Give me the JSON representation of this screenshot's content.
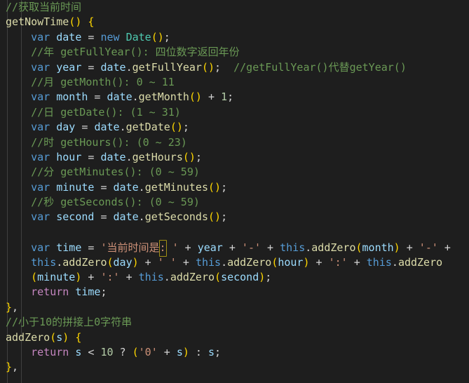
{
  "editor": {
    "theme_name": "dark-plus",
    "background_color": "#1e1e1e",
    "language": "javascript",
    "font_size_px": 15,
    "line_height_px": 21.4,
    "colors": {
      "comment": "#6a9955",
      "keyword": "#569cd6",
      "identifier": "#9cdcfe",
      "function": "#dcdcaa",
      "type": "#4ec9b0",
      "string": "#ce9178",
      "number": "#b5cea8",
      "control": "#c586c0",
      "punctuation": "#d4d4d4",
      "bracket_level_0": "#ffd700",
      "bracket_level_1": "#da70d6",
      "bracket_level_2": "#179fff",
      "indent_guide": "#404040",
      "match_highlight_border": "#a39014"
    },
    "indent_guides": [
      10,
      30
    ],
    "partial_top_line_text": "//"
  },
  "lines": [
    {
      "n": 1,
      "tokens": [
        {
          "c": "t-com",
          "s": "//获取当前时间"
        }
      ]
    },
    {
      "n": 2,
      "tokens": [
        {
          "c": "t-fn",
          "s": "getNowTime"
        },
        {
          "c": "t-br0",
          "s": "()"
        },
        {
          "c": "t-pun",
          "s": " "
        },
        {
          "c": "t-br0",
          "s": "{"
        }
      ]
    },
    {
      "n": 3,
      "tokens": [
        {
          "c": "t-pun",
          "s": "    "
        },
        {
          "c": "t-kw",
          "s": "var"
        },
        {
          "c": "t-pun",
          "s": " "
        },
        {
          "c": "t-var",
          "s": "date"
        },
        {
          "c": "t-op",
          "s": " = "
        },
        {
          "c": "t-kw",
          "s": "new"
        },
        {
          "c": "t-pun",
          "s": " "
        },
        {
          "c": "t-type",
          "s": "Date"
        },
        {
          "c": "t-br0",
          "s": "()"
        },
        {
          "c": "t-pun",
          "s": ";"
        }
      ]
    },
    {
      "n": 4,
      "tokens": [
        {
          "c": "t-pun",
          "s": "    "
        },
        {
          "c": "t-com",
          "s": "//年 getFullYear(): 四位数字返回年份"
        }
      ]
    },
    {
      "n": 5,
      "tokens": [
        {
          "c": "t-pun",
          "s": "    "
        },
        {
          "c": "t-kw",
          "s": "var"
        },
        {
          "c": "t-pun",
          "s": " "
        },
        {
          "c": "t-var",
          "s": "year"
        },
        {
          "c": "t-op",
          "s": " = "
        },
        {
          "c": "t-var",
          "s": "date"
        },
        {
          "c": "t-pun",
          "s": "."
        },
        {
          "c": "t-fn",
          "s": "getFullYear"
        },
        {
          "c": "t-br0",
          "s": "()"
        },
        {
          "c": "t-pun",
          "s": ";  "
        },
        {
          "c": "t-com",
          "s": "//getFullYear()代替getYear()"
        }
      ]
    },
    {
      "n": 6,
      "tokens": [
        {
          "c": "t-pun",
          "s": "    "
        },
        {
          "c": "t-com",
          "s": "//月 getMonth(): 0 ~ 11"
        }
      ]
    },
    {
      "n": 7,
      "tokens": [
        {
          "c": "t-pun",
          "s": "    "
        },
        {
          "c": "t-kw",
          "s": "var"
        },
        {
          "c": "t-pun",
          "s": " "
        },
        {
          "c": "t-var",
          "s": "month"
        },
        {
          "c": "t-op",
          "s": " = "
        },
        {
          "c": "t-var",
          "s": "date"
        },
        {
          "c": "t-pun",
          "s": "."
        },
        {
          "c": "t-fn",
          "s": "getMonth"
        },
        {
          "c": "t-br0",
          "s": "()"
        },
        {
          "c": "t-op",
          "s": " + "
        },
        {
          "c": "t-num",
          "s": "1"
        },
        {
          "c": "t-pun",
          "s": ";"
        }
      ]
    },
    {
      "n": 8,
      "tokens": [
        {
          "c": "t-pun",
          "s": "    "
        },
        {
          "c": "t-com",
          "s": "//日 getDate(): (1 ~ 31)"
        }
      ]
    },
    {
      "n": 9,
      "tokens": [
        {
          "c": "t-pun",
          "s": "    "
        },
        {
          "c": "t-kw",
          "s": "var"
        },
        {
          "c": "t-pun",
          "s": " "
        },
        {
          "c": "t-var",
          "s": "day"
        },
        {
          "c": "t-op",
          "s": " = "
        },
        {
          "c": "t-var",
          "s": "date"
        },
        {
          "c": "t-pun",
          "s": "."
        },
        {
          "c": "t-fn",
          "s": "getDate"
        },
        {
          "c": "t-br0",
          "s": "()"
        },
        {
          "c": "t-pun",
          "s": ";"
        }
      ]
    },
    {
      "n": 10,
      "tokens": [
        {
          "c": "t-pun",
          "s": "    "
        },
        {
          "c": "t-com",
          "s": "//时 getHours(): (0 ~ 23)"
        }
      ]
    },
    {
      "n": 11,
      "tokens": [
        {
          "c": "t-pun",
          "s": "    "
        },
        {
          "c": "t-kw",
          "s": "var"
        },
        {
          "c": "t-pun",
          "s": " "
        },
        {
          "c": "t-var",
          "s": "hour"
        },
        {
          "c": "t-op",
          "s": " = "
        },
        {
          "c": "t-var",
          "s": "date"
        },
        {
          "c": "t-pun",
          "s": "."
        },
        {
          "c": "t-fn",
          "s": "getHours"
        },
        {
          "c": "t-br0",
          "s": "()"
        },
        {
          "c": "t-pun",
          "s": ";"
        }
      ]
    },
    {
      "n": 12,
      "tokens": [
        {
          "c": "t-pun",
          "s": "    "
        },
        {
          "c": "t-com",
          "s": "//分 getMinutes(): (0 ~ 59)"
        }
      ]
    },
    {
      "n": 13,
      "tokens": [
        {
          "c": "t-pun",
          "s": "    "
        },
        {
          "c": "t-kw",
          "s": "var"
        },
        {
          "c": "t-pun",
          "s": " "
        },
        {
          "c": "t-var",
          "s": "minute"
        },
        {
          "c": "t-op",
          "s": " = "
        },
        {
          "c": "t-var",
          "s": "date"
        },
        {
          "c": "t-pun",
          "s": "."
        },
        {
          "c": "t-fn",
          "s": "getMinutes"
        },
        {
          "c": "t-br0",
          "s": "()"
        },
        {
          "c": "t-pun",
          "s": ";"
        }
      ]
    },
    {
      "n": 14,
      "tokens": [
        {
          "c": "t-pun",
          "s": "    "
        },
        {
          "c": "t-com",
          "s": "//秒 getSeconds(): (0 ~ 59)"
        }
      ]
    },
    {
      "n": 15,
      "tokens": [
        {
          "c": "t-pun",
          "s": "    "
        },
        {
          "c": "t-kw",
          "s": "var"
        },
        {
          "c": "t-pun",
          "s": " "
        },
        {
          "c": "t-var",
          "s": "second"
        },
        {
          "c": "t-op",
          "s": " = "
        },
        {
          "c": "t-var",
          "s": "date"
        },
        {
          "c": "t-pun",
          "s": "."
        },
        {
          "c": "t-fn",
          "s": "getSeconds"
        },
        {
          "c": "t-br0",
          "s": "()"
        },
        {
          "c": "t-pun",
          "s": ";"
        }
      ]
    },
    {
      "n": 16,
      "tokens": []
    },
    {
      "n": 17,
      "tokens": [
        {
          "c": "t-pun",
          "s": "    "
        },
        {
          "c": "t-kw",
          "s": "var"
        },
        {
          "c": "t-pun",
          "s": " "
        },
        {
          "c": "t-var",
          "s": "time"
        },
        {
          "c": "t-op",
          "s": " = "
        },
        {
          "c": "t-str",
          "s": "'当前时间是"
        },
        {
          "c": "t-str",
          "s": ":",
          "match": true
        },
        {
          "c": "t-str",
          "s": " '"
        },
        {
          "c": "t-op",
          "s": " + "
        },
        {
          "c": "t-var",
          "s": "year"
        },
        {
          "c": "t-op",
          "s": " + "
        },
        {
          "c": "t-str",
          "s": "'-'"
        },
        {
          "c": "t-op",
          "s": " + "
        },
        {
          "c": "t-kw",
          "s": "this"
        },
        {
          "c": "t-pun",
          "s": "."
        },
        {
          "c": "t-fn",
          "s": "addZero"
        },
        {
          "c": "t-br0",
          "s": "("
        },
        {
          "c": "t-var",
          "s": "month"
        },
        {
          "c": "t-br0",
          "s": ")"
        },
        {
          "c": "t-op",
          "s": " + "
        },
        {
          "c": "t-str",
          "s": "'-'"
        },
        {
          "c": "t-op",
          "s": " +"
        }
      ]
    },
    {
      "n": 18,
      "tokens": [
        {
          "c": "t-pun",
          "s": "    "
        },
        {
          "c": "t-kw",
          "s": "this"
        },
        {
          "c": "t-pun",
          "s": "."
        },
        {
          "c": "t-fn",
          "s": "addZero"
        },
        {
          "c": "t-br0",
          "s": "("
        },
        {
          "c": "t-var",
          "s": "day"
        },
        {
          "c": "t-br0",
          "s": ")"
        },
        {
          "c": "t-op",
          "s": " + "
        },
        {
          "c": "t-str",
          "s": "' '"
        },
        {
          "c": "t-op",
          "s": " + "
        },
        {
          "c": "t-kw",
          "s": "this"
        },
        {
          "c": "t-pun",
          "s": "."
        },
        {
          "c": "t-fn",
          "s": "addZero"
        },
        {
          "c": "t-br0",
          "s": "("
        },
        {
          "c": "t-var",
          "s": "hour"
        },
        {
          "c": "t-br0",
          "s": ")"
        },
        {
          "c": "t-op",
          "s": " + "
        },
        {
          "c": "t-str",
          "s": "':'"
        },
        {
          "c": "t-op",
          "s": " + "
        },
        {
          "c": "t-kw",
          "s": "this"
        },
        {
          "c": "t-pun",
          "s": "."
        },
        {
          "c": "t-fn",
          "s": "addZero"
        }
      ]
    },
    {
      "n": 19,
      "tokens": [
        {
          "c": "t-pun",
          "s": "    "
        },
        {
          "c": "t-br0",
          "s": "("
        },
        {
          "c": "t-var",
          "s": "minute"
        },
        {
          "c": "t-br0",
          "s": ")"
        },
        {
          "c": "t-op",
          "s": " + "
        },
        {
          "c": "t-str",
          "s": "':'"
        },
        {
          "c": "t-op",
          "s": " + "
        },
        {
          "c": "t-kw",
          "s": "this"
        },
        {
          "c": "t-pun",
          "s": "."
        },
        {
          "c": "t-fn",
          "s": "addZero"
        },
        {
          "c": "t-br0",
          "s": "("
        },
        {
          "c": "t-var",
          "s": "second"
        },
        {
          "c": "t-br0",
          "s": ")"
        },
        {
          "c": "t-pun",
          "s": ";"
        }
      ]
    },
    {
      "n": 20,
      "tokens": [
        {
          "c": "t-pun",
          "s": "    "
        },
        {
          "c": "t-ctl",
          "s": "return"
        },
        {
          "c": "t-pun",
          "s": " "
        },
        {
          "c": "t-var",
          "s": "time"
        },
        {
          "c": "t-pun",
          "s": ";"
        }
      ]
    },
    {
      "n": 21,
      "tokens": [
        {
          "c": "t-br0",
          "s": "}"
        },
        {
          "c": "t-pun",
          "s": ","
        }
      ]
    },
    {
      "n": 22,
      "tokens": [
        {
          "c": "t-com",
          "s": "//小于10的拼接上0字符串"
        }
      ]
    },
    {
      "n": 23,
      "tokens": [
        {
          "c": "t-fn",
          "s": "addZero"
        },
        {
          "c": "t-br0",
          "s": "("
        },
        {
          "c": "t-var",
          "s": "s"
        },
        {
          "c": "t-br0",
          "s": ")"
        },
        {
          "c": "t-pun",
          "s": " "
        },
        {
          "c": "t-br0",
          "s": "{"
        }
      ]
    },
    {
      "n": 24,
      "tokens": [
        {
          "c": "t-pun",
          "s": "    "
        },
        {
          "c": "t-ctl",
          "s": "return"
        },
        {
          "c": "t-pun",
          "s": " "
        },
        {
          "c": "t-var",
          "s": "s"
        },
        {
          "c": "t-op",
          "s": " < "
        },
        {
          "c": "t-num",
          "s": "10"
        },
        {
          "c": "t-op",
          "s": " ? "
        },
        {
          "c": "t-br0",
          "s": "("
        },
        {
          "c": "t-str",
          "s": "'0'"
        },
        {
          "c": "t-op",
          "s": " + "
        },
        {
          "c": "t-var",
          "s": "s"
        },
        {
          "c": "t-br0",
          "s": ")"
        },
        {
          "c": "t-op",
          "s": " : "
        },
        {
          "c": "t-var",
          "s": "s"
        },
        {
          "c": "t-pun",
          "s": ";"
        }
      ]
    },
    {
      "n": 25,
      "tokens": [
        {
          "c": "t-br0",
          "s": "}"
        },
        {
          "c": "t-pun",
          "s": ","
        }
      ]
    }
  ]
}
